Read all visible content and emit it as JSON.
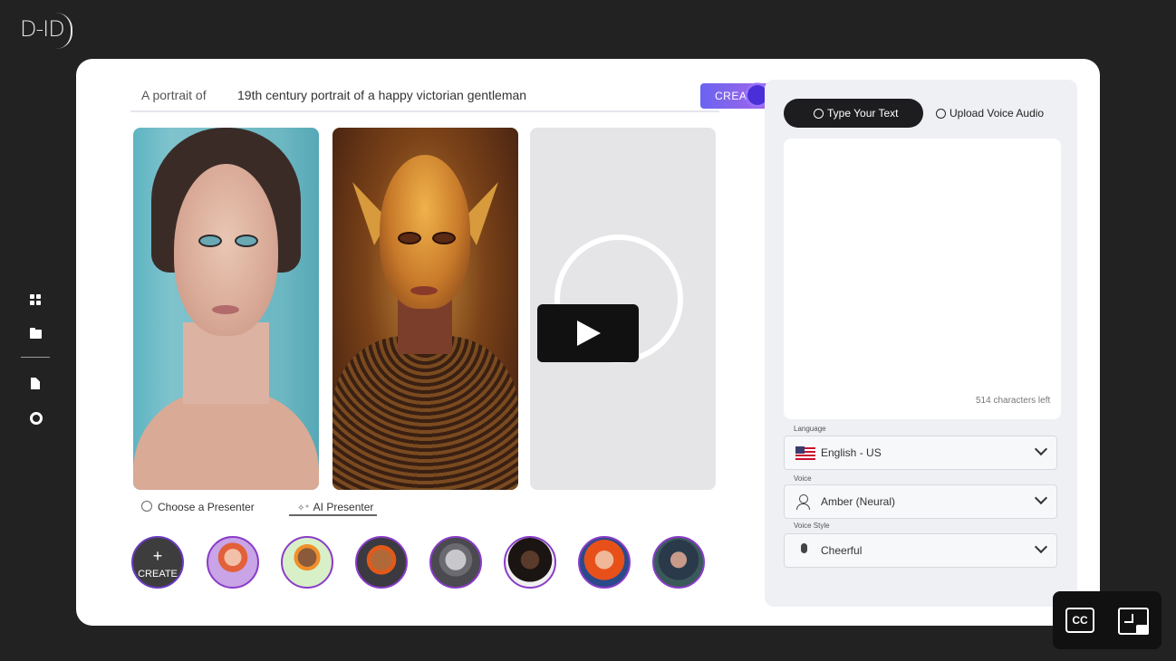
{
  "brand": {
    "logo_text": "D-ID"
  },
  "sidebar": {
    "icons": [
      "grid-icon",
      "folder-icon",
      "document-icon",
      "help-ring-icon"
    ]
  },
  "prompt": {
    "label": "A portrait of",
    "value": "19th century portrait of a happy victorian gentleman",
    "create_label": "CREATE"
  },
  "presenter_tabs": {
    "choose_label": "Choose a Presenter",
    "ai_label": "AI Presenter",
    "active": "AI Presenter"
  },
  "avatars": {
    "create_plus": "+",
    "create_label": "CREATE",
    "colors": [
      "#c9a4e6",
      "#b8e0b0",
      "#d06b3a",
      "#8a8a90",
      "#2a2420",
      "#e25a2a",
      "#3a3a5a"
    ]
  },
  "right_panel": {
    "type_text_tab": "Type Your Text",
    "upload_audio_tab": "Upload Voice Audio",
    "chars_left": "514 characters left",
    "language_label": "Language",
    "language_value": "English - US",
    "voice_label": "Voice",
    "voice_value": "Amber (Neural)",
    "voice_style_label": "Voice Style",
    "voice_style_value": "Cheerful"
  },
  "player": {
    "cc_label": "CC"
  },
  "colors": {
    "accent_gradient_start": "#6a64f0",
    "accent_gradient_end": "#a866e8",
    "avatar_border": "#8a3cc8",
    "background": "#222222"
  }
}
